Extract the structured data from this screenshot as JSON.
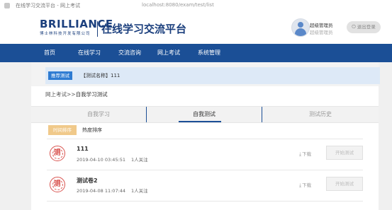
{
  "browser": {
    "tab_text": "在线学习交流平台 - 网上考试",
    "url_text": "localhost:8080/exam/test/list"
  },
  "header": {
    "brand_name": "BRILLIANCE",
    "brand_sub": "博士林科技开发有限公司",
    "platform_title": "在线学习交流平台",
    "user_role": "超级管理员",
    "user_name": "超级管理员",
    "logout_label": "退出登录",
    "logout_icon": "power-icon"
  },
  "nav": {
    "items": [
      {
        "label": "首页"
      },
      {
        "label": "在线学习"
      },
      {
        "label": "交流咨询"
      },
      {
        "label": "网上考试"
      },
      {
        "label": "系统管理"
      }
    ]
  },
  "tag_bar": {
    "badge": "推荐测试",
    "text": "【测试名称】111"
  },
  "breadcrumb": {
    "parent": "网上考试",
    "separator": ">>",
    "current": "自我学习测试"
  },
  "tabs": [
    {
      "label": "自我学习",
      "active": false
    },
    {
      "label": "自我测试",
      "active": true
    },
    {
      "label": "测试历史",
      "active": false
    }
  ],
  "sort": {
    "time_label": "时间排序",
    "hot_label": "热度排序"
  },
  "exams": [
    {
      "title": "111",
      "date": "2019-04-10 03:45:51",
      "followers": "1人关注",
      "seal_char": "测",
      "download_label": "下载",
      "start_label": "开始测试"
    },
    {
      "title": "测试卷2",
      "date": "2019-04-08 11:07:44",
      "followers": "1人关注",
      "seal_char": "测",
      "download_label": "下载",
      "start_label": "开始测试"
    }
  ],
  "colors": {
    "nav_bg": "#1b4f96",
    "brand": "#1b3f7d",
    "badge": "#2e7bd2",
    "sort_active": "#f0c98a",
    "seal": "#d9534f"
  }
}
